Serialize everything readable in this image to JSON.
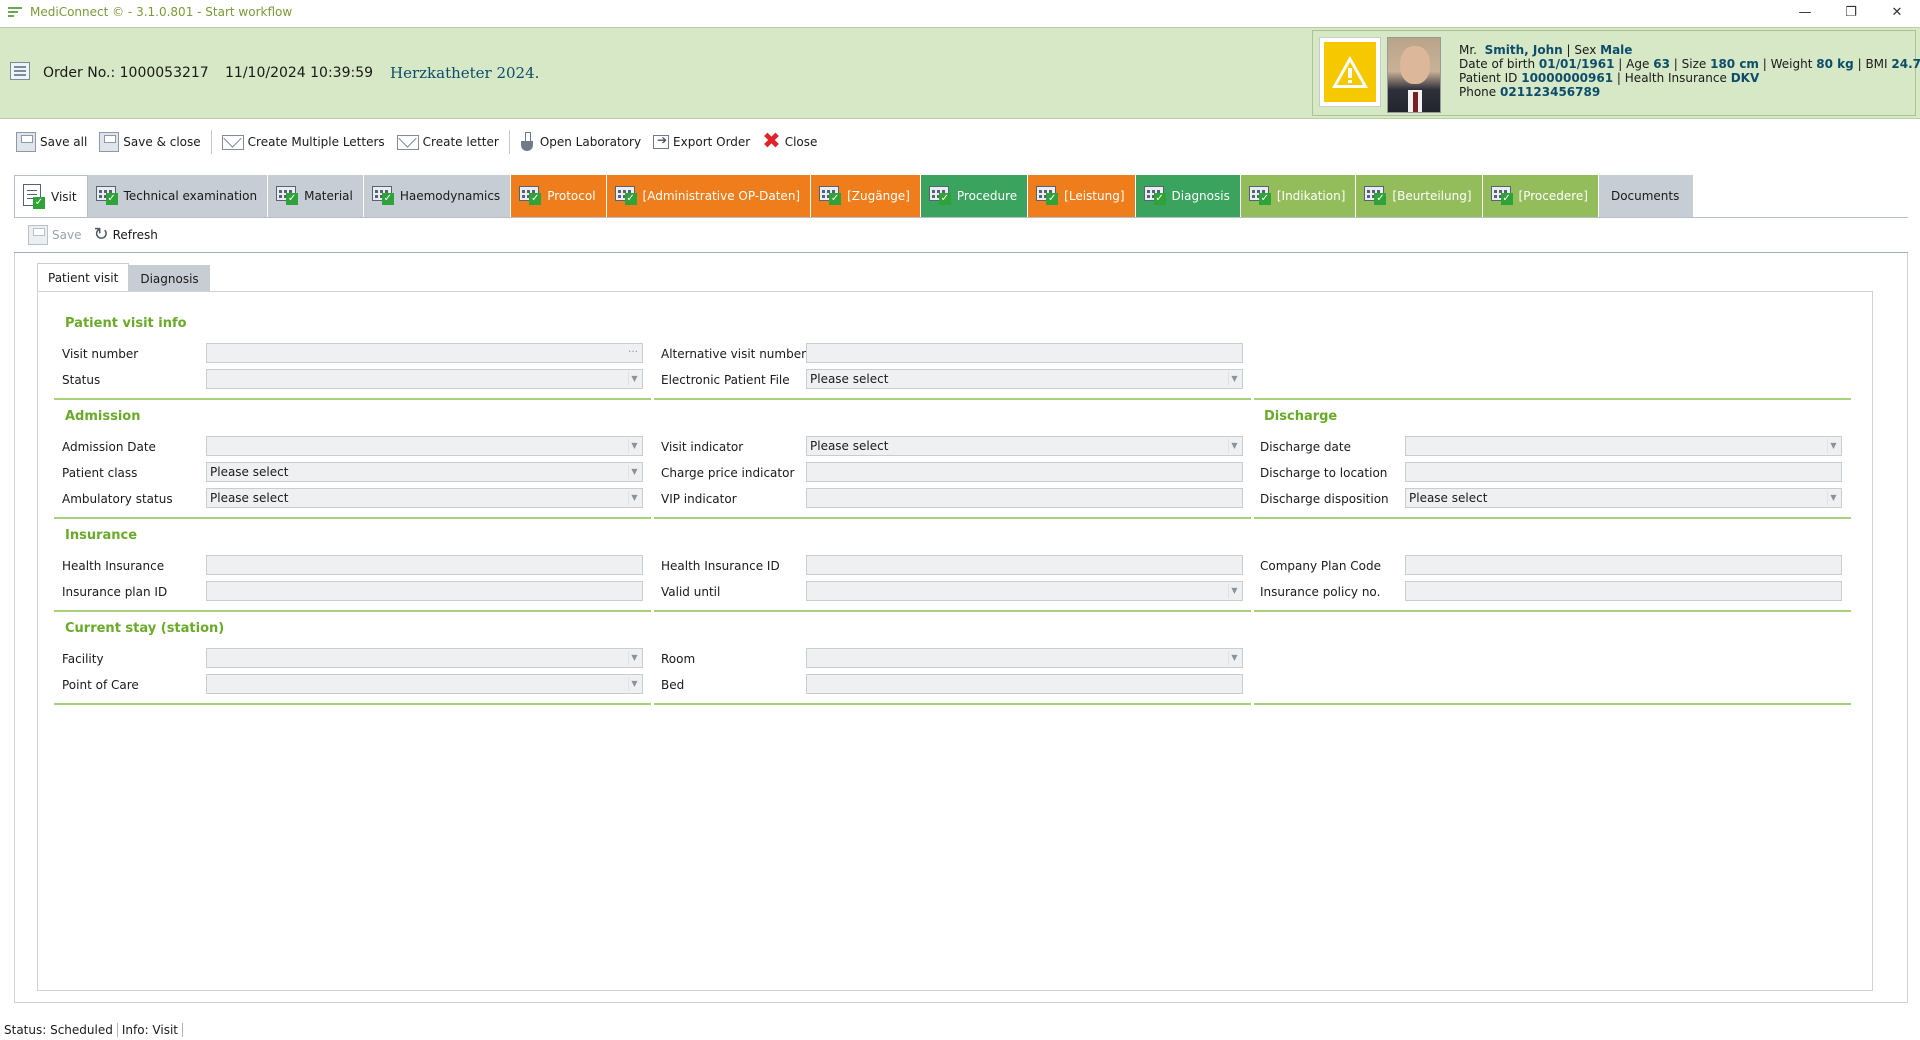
{
  "window": {
    "title": "MediConnect © - 3.1.0.801 - Start workflow",
    "controls": [
      "—",
      "❐",
      "✕"
    ]
  },
  "header": {
    "order_no": "Order No.: 1000053217",
    "order_datetime": "11/10/2024 10:39:59",
    "procedure": "Herzkatheter 2024.",
    "patient": {
      "salutation": "Mr.",
      "name": "Smith, John",
      "sex_label": "Sex",
      "sex": "Male",
      "dob_label": "Date of birth",
      "dob": "01/01/1961",
      "age_label": "Age",
      "age": "63",
      "size_label": "Size",
      "size": "180 cm",
      "weight_label": "Weight",
      "weight": "80 kg",
      "bmi_label": "BMI",
      "bmi": "24.7",
      "patient_id_label": "Patient ID",
      "patient_id": "10000000961",
      "insurance_label": "Health Insurance",
      "insurance": "DKV",
      "phone_label": "Phone",
      "phone": "021123456789",
      "sep": "|"
    }
  },
  "toolbar": {
    "save_all": "Save all",
    "save_close": "Save & close",
    "create_multiple_letters": "Create Multiple Letters",
    "create_letter": "Create letter",
    "open_laboratory": "Open Laboratory",
    "export_order": "Export Order",
    "close": "Close"
  },
  "workflow_tabs": [
    {
      "label": "Visit",
      "style": "active"
    },
    {
      "label": "Technical examination",
      "style": "gray"
    },
    {
      "label": "Material",
      "style": "gray"
    },
    {
      "label": "Haemodynamics",
      "style": "gray"
    },
    {
      "label": "Protocol",
      "style": "orange"
    },
    {
      "label": "[Administrative OP-Daten]",
      "style": "orange"
    },
    {
      "label": "[Zugänge]",
      "style": "orange"
    },
    {
      "label": "Procedure",
      "style": "green"
    },
    {
      "label": "[Leistung]",
      "style": "orange"
    },
    {
      "label": "Diagnosis",
      "style": "green"
    },
    {
      "label": "[Indikation]",
      "style": "lgreen"
    },
    {
      "label": "[Beurteilung]",
      "style": "lgreen"
    },
    {
      "label": "[Procedere]",
      "style": "lgreen"
    },
    {
      "label": "Documents",
      "style": "gray"
    }
  ],
  "subtoolbar": {
    "save": "Save",
    "refresh": "Refresh"
  },
  "panel_tabs": {
    "patient_visit": "Patient visit",
    "diagnosis": "Diagnosis"
  },
  "sections": {
    "patient_visit_info": "Patient visit info",
    "admission": "Admission",
    "discharge": "Discharge",
    "insurance": "Insurance",
    "current_stay": "Current stay (station)"
  },
  "labels": {
    "visit_number": "Visit number",
    "status": "Status",
    "alternative_visit_number": "Alternative visit number",
    "electronic_patient_file": "Electronic Patient File",
    "admission_date": "Admission Date",
    "patient_class": "Patient class",
    "ambulatory_status": "Ambulatory status",
    "visit_indicator": "Visit indicator",
    "charge_price_indicator": "Charge price indicator",
    "vip_indicator": "VIP indicator",
    "discharge_date": "Discharge date",
    "discharge_to_location": "Discharge to location",
    "discharge_disposition": "Discharge disposition",
    "health_insurance": "Health Insurance",
    "insurance_plan_id": "Insurance plan ID",
    "health_insurance_id": "Health Insurance ID",
    "valid_until": "Valid until",
    "company_plan_code": "Company Plan Code",
    "insurance_policy_no": "Insurance policy no.",
    "facility": "Facility",
    "point_of_care": "Point of Care",
    "room": "Room",
    "bed": "Bed"
  },
  "values": {
    "visit_number": "",
    "status": "",
    "alternative_visit_number": "",
    "electronic_patient_file": "Please select",
    "admission_date": "",
    "patient_class": "Please select",
    "ambulatory_status": "Please select",
    "visit_indicator": "Please select",
    "charge_price_indicator": "",
    "vip_indicator": "",
    "discharge_date": "",
    "discharge_to_location": "",
    "discharge_disposition": "Please select",
    "health_insurance": "",
    "insurance_plan_id": "",
    "health_insurance_id": "",
    "valid_until": "",
    "company_plan_code": "",
    "insurance_policy_no": "",
    "facility": "",
    "point_of_care": "",
    "room": "",
    "bed": ""
  },
  "statusbar": {
    "status": "Status: Scheduled",
    "info": "Info: Visit"
  },
  "colors": {
    "header_bg": "#d6e8c5",
    "section_title": "#6aaa2a",
    "tab_orange": "#f07d1b",
    "tab_green": "#3aa35e",
    "tab_light_green": "#93bd5a",
    "tab_gray": "#c6cdd4",
    "warning": "#f5c800"
  },
  "icons": {
    "app": "mediconnect-logo-icon",
    "warning": "warning-triangle-icon",
    "save": "floppy-disk-icon",
    "letter": "envelope-icon",
    "lab": "flask-icon",
    "export": "export-icon",
    "close": "red-x-icon",
    "refresh": "refresh-icon",
    "tab": "calendar-check-icon"
  }
}
